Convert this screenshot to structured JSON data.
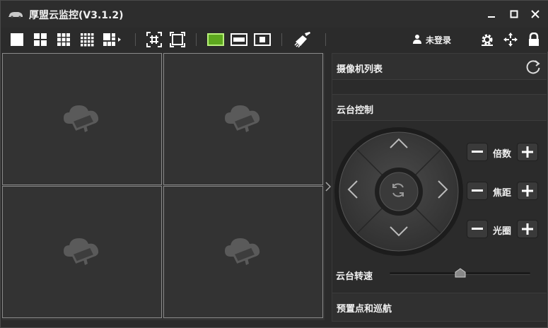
{
  "app": {
    "title": "厚盟云监控(V3.1.2)",
    "logo_icon": "camera-logo-icon"
  },
  "window_controls": [
    "minimize-icon",
    "maximize-icon",
    "close-icon"
  ],
  "toolbar": {
    "layout_buttons": [
      "layout-1-icon",
      "layout-4-icon",
      "layout-9-icon",
      "layout-16-icon",
      "layout-custom-icon"
    ],
    "view_buttons": [
      "fit-window-icon",
      "fullscreen-icon"
    ],
    "stream_buttons": [
      "stream-main-icon",
      "stream-wide-icon",
      "stream-single-icon"
    ],
    "clear_icon": "broom-icon",
    "user_label": "未登录",
    "right_icons": [
      "settings-icon",
      "network-icon",
      "lock-icon"
    ]
  },
  "grid": {
    "cells": 4,
    "placeholder_icon": "cloud-camera-icon"
  },
  "panel": {
    "camera_list_title": "摄像机列表",
    "ptz_title": "云台控制",
    "zoom_label": "倍数",
    "focus_label": "焦距",
    "iris_label": "光圈",
    "speed_label": "云台转速",
    "speed_value": 0.5,
    "preset_title": "预置点和巡航"
  },
  "colors": {
    "accent_green": "#7ac143",
    "bg": "#2b2b2b"
  }
}
